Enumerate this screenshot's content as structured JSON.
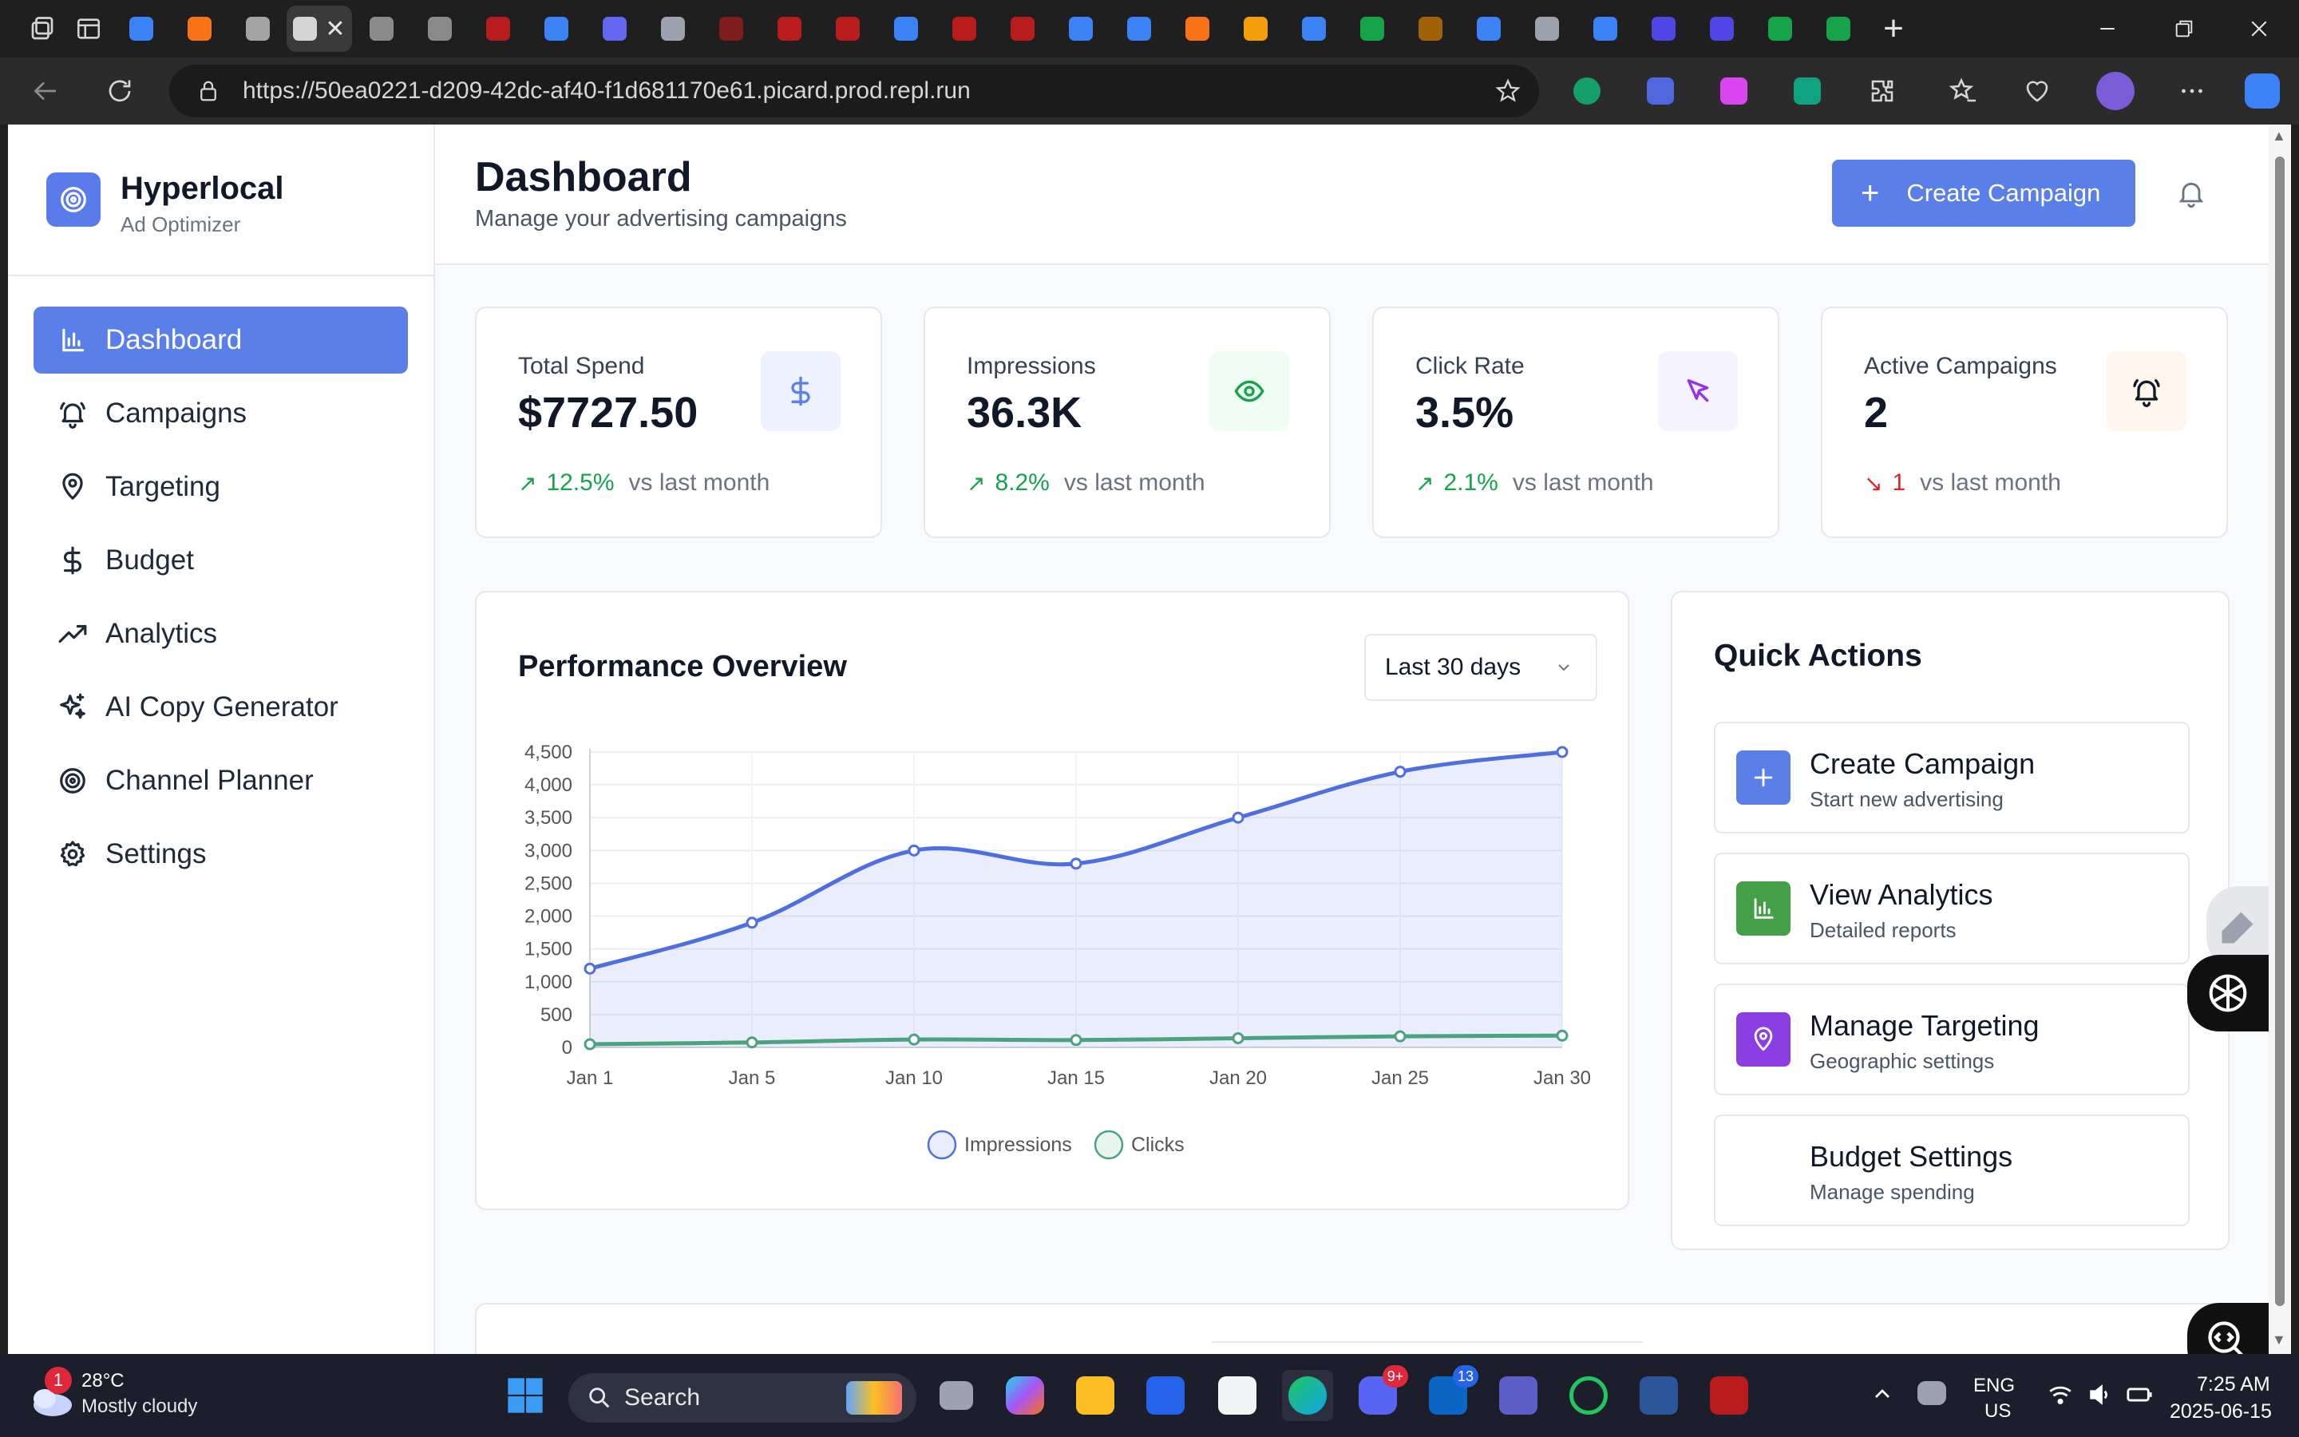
{
  "browser": {
    "url": "https://50ea0221-d209-42dc-af40-f1d681170e61.picard.prod.repl.run",
    "tab_colors": [
      "#3b82f6",
      "#f97316",
      "#a3a3a3",
      "#d4d4d4",
      "#8a8a8a",
      "#8a8a8a",
      "#b91c1c",
      "#3b82f6",
      "#6366f1",
      "#9ca3af",
      "#7f1d1d",
      "#b91c1c",
      "#b91c1c",
      "#3b82f6",
      "#b91c1c",
      "#b91c1c",
      "#3b82f6",
      "#3b82f6",
      "#f97316",
      "#f59e0b",
      "#3b82f6",
      "#16a34a",
      "#a16207",
      "#3b82f6",
      "#9ca3af",
      "#3b82f6",
      "#4f46e5",
      "#4f46e5",
      "#16a34a",
      "#16a34a"
    ],
    "new_tab_label": "+"
  },
  "app": {
    "brand_name": "Hyperlocal",
    "brand_sub": "Ad Optimizer",
    "accent": "#5b7fe9"
  },
  "sidebar": {
    "items": [
      {
        "label": "Dashboard",
        "icon": "bar-chart-icon",
        "active": true
      },
      {
        "label": "Campaigns",
        "icon": "bell-ring-icon",
        "active": false
      },
      {
        "label": "Targeting",
        "icon": "map-pin-icon",
        "active": false
      },
      {
        "label": "Budget",
        "icon": "dollar-icon",
        "active": false
      },
      {
        "label": "Analytics",
        "icon": "trending-up-icon",
        "active": false
      },
      {
        "label": "AI Copy Generator",
        "icon": "sparkles-icon",
        "active": false
      },
      {
        "label": "Channel Planner",
        "icon": "target-icon",
        "active": false
      },
      {
        "label": "Settings",
        "icon": "gear-icon",
        "active": false
      }
    ]
  },
  "header": {
    "title": "Dashboard",
    "subtitle": "Manage your advertising campaigns",
    "create_button": "Create Campaign"
  },
  "stats": [
    {
      "label": "Total Spend",
      "value": "$7727.50",
      "change": "12.5%",
      "direction": "up",
      "compare": "vs last month",
      "icon": "dollar-icon",
      "chip_color": "#eef2ff",
      "icon_color": "#5b7fe9"
    },
    {
      "label": "Impressions",
      "value": "36.3K",
      "change": "8.2%",
      "direction": "up",
      "compare": "vs last month",
      "icon": "eye-icon",
      "chip_color": "#f0fdf4",
      "icon_color": "#16a34a"
    },
    {
      "label": "Click Rate",
      "value": "3.5%",
      "change": "2.1%",
      "direction": "up",
      "compare": "vs last month",
      "icon": "cursor-icon",
      "chip_color": "#f5f3ff",
      "icon_color": "#9333ea"
    },
    {
      "label": "Active Campaigns",
      "value": "2",
      "change": "1",
      "direction": "down",
      "compare": "vs last month",
      "icon": "bell-ring-icon",
      "chip_color": "#fff7ed",
      "icon_color": "#111827"
    }
  ],
  "performance": {
    "title": "Performance Overview",
    "range_selected": "Last 30 days"
  },
  "chart_data": {
    "type": "line",
    "title": "Performance Overview",
    "x": [
      "Jan 1",
      "Jan 5",
      "Jan 10",
      "Jan 15",
      "Jan 20",
      "Jan 25",
      "Jan 30"
    ],
    "series": [
      {
        "name": "Impressions",
        "values": [
          1200,
          1900,
          3000,
          2800,
          3500,
          4200,
          4500
        ],
        "color": "#4f6fe0",
        "fill": true
      },
      {
        "name": "Clicks",
        "values": [
          48,
          76,
          120,
          112,
          140,
          168,
          180
        ],
        "color": "#4aa37e",
        "fill": false
      }
    ],
    "y_ticks": [
      "0",
      "500",
      "1,000",
      "1,500",
      "2,000",
      "2,500",
      "3,000",
      "3,500",
      "4,000",
      "4,500"
    ],
    "ylim": [
      0,
      4500
    ],
    "grid": true,
    "legend": "bottom",
    "xlabel": "",
    "ylabel": ""
  },
  "quick_actions": {
    "title": "Quick Actions",
    "items": [
      {
        "title": "Create Campaign",
        "sub": "Start new advertising",
        "icon": "plus-icon",
        "color": "#5b7fe9"
      },
      {
        "title": "View Analytics",
        "sub": "Detailed reports",
        "icon": "bar-chart-icon",
        "color": "#43a047"
      },
      {
        "title": "Manage Targeting",
        "sub": "Geographic settings",
        "icon": "map-pin-icon",
        "color": "#8b3fe3"
      },
      {
        "title": "Budget Settings",
        "sub": "Manage spending",
        "icon": "dollar-icon",
        "color": "#ffffff"
      }
    ]
  },
  "taskbar": {
    "weather_temp": "28°C",
    "weather_cond": "Mostly cloudy",
    "weather_badge": "1",
    "search_label": "Search",
    "discord_badge": "9+",
    "linkedin_badge": "13",
    "lang_1": "ENG",
    "lang_2": "US",
    "time": "7:25 AM",
    "date": "2025-06-15"
  }
}
